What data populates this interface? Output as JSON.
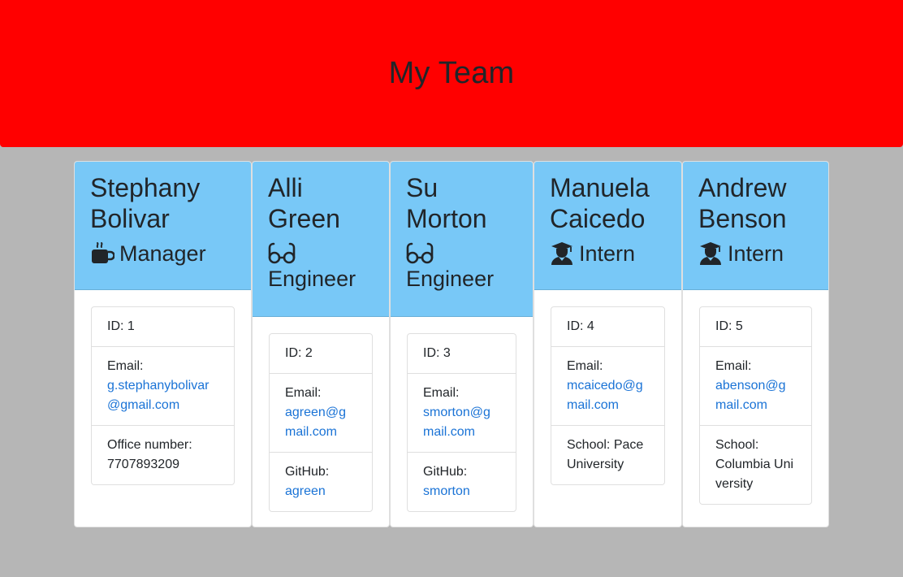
{
  "header": {
    "title": "My Team"
  },
  "colors": {
    "header_bg": "#ff0000",
    "card_header_bg": "#78c8f7",
    "page_bg": "#b6b6b6",
    "link": "#1a73d6"
  },
  "cards": [
    {
      "name": "Stephany Bolivar",
      "role": "Manager",
      "role_icon": "coffee-mug-icon",
      "id_text": "ID: 1",
      "email_label": "Email:",
      "email": "g.stephanybolivar@gmail.com",
      "extra_label": "Office number:",
      "extra_value": "7707893209"
    },
    {
      "name": "Alli Green",
      "role": "Engineer",
      "role_icon": "glasses-icon",
      "id_text": "ID: 2",
      "email_label": "Email:",
      "email": "agreen@gmail.com",
      "extra_label": "GitHub:",
      "extra_value": "agreen"
    },
    {
      "name": "Su Morton",
      "role": "Engineer",
      "role_icon": "glasses-icon",
      "id_text": "ID: 3",
      "email_label": "Email:",
      "email": "smorton@gmail.com",
      "extra_label": "GitHub:",
      "extra_value": "smorton"
    },
    {
      "name": "Manuela Caicedo",
      "role": "Intern",
      "role_icon": "graduate-icon",
      "id_text": "ID: 4",
      "email_label": "Email:",
      "email": "mcaicedo@gmail.com",
      "extra_label": "School:",
      "extra_value": "Pace University"
    },
    {
      "name": "Andrew Benson",
      "role": "Intern",
      "role_icon": "graduate-icon",
      "id_text": "ID: 5",
      "email_label": "Email:",
      "email": "abenson@gmail.com",
      "extra_label": "School:",
      "extra_value": "Columbia University"
    }
  ]
}
